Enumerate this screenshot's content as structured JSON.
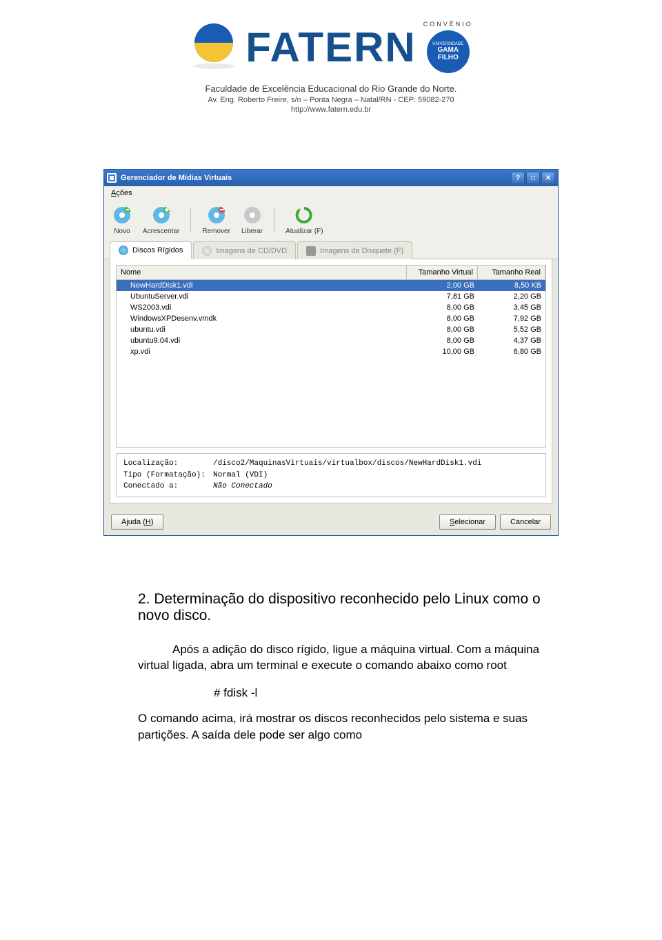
{
  "header": {
    "logo_text": "FATERN",
    "convenio_label": "CONVÊNIO",
    "gama_line1": "UNIVERSIDADE",
    "gama_line2": "GAMA",
    "gama_line3": "FILHO",
    "subtitle": "Faculdade de Excelência Educacional do Rio Grande do Norte.",
    "address": "Av. Eng. Roberto Freire, s/n – Ponta Negra – Natal/RN - CEP: 59082-270",
    "url": "http://www.fatern.edu.br"
  },
  "window": {
    "title": "Gerenciador de Mídias Virtuais",
    "menu": {
      "acoes": "Ações"
    },
    "toolbar": {
      "novo": "Novo",
      "acrescentar": "Acrescentar",
      "remover": "Remover",
      "liberar": "Liberar",
      "atualizar": "Atualizar (F)"
    },
    "tabs": {
      "discos": "Discos Rígidos",
      "cddvd": "Imagens de CD/DVD",
      "disquete": "Imagens de Disquete (F)"
    },
    "columns": {
      "nome": "Nome",
      "tam_virtual": "Tamanho Virtual",
      "tam_real": "Tamanho Real"
    },
    "rows": [
      {
        "name": "NewHardDisk1.vdi",
        "virt": "2,00 GB",
        "real": "8,50 KB",
        "selected": true
      },
      {
        "name": "UbuntuServer.vdi",
        "virt": "7,81 GB",
        "real": "2,20 GB",
        "selected": false
      },
      {
        "name": "WS2003.vdi",
        "virt": "8,00 GB",
        "real": "3,45 GB",
        "selected": false
      },
      {
        "name": "WindowsXPDesenv.vmdk",
        "virt": "8,00 GB",
        "real": "7,92 GB",
        "selected": false
      },
      {
        "name": "ubuntu.vdi",
        "virt": "8,00 GB",
        "real": "5,52 GB",
        "selected": false
      },
      {
        "name": "ubuntu9.04.vdi",
        "virt": "8,00 GB",
        "real": "4,37 GB",
        "selected": false
      },
      {
        "name": "xp.vdi",
        "virt": "10,00 GB",
        "real": "6,80 GB",
        "selected": false
      }
    ],
    "details": {
      "loc_label": "Localização:",
      "loc_val": "/disco2/MaquinasVirtuais/virtualbox/discos/NewHardDisk1.vdi",
      "tipo_label": "Tipo (Formatação):",
      "tipo_val": "Normal (VDI)",
      "conn_label": "Conectado a:",
      "conn_val": "Não Conectado"
    },
    "btns": {
      "ajuda": "Ajuda (H)",
      "selecionar": "Selecionar",
      "cancelar": "Cancelar"
    }
  },
  "doc": {
    "heading": "2. Determinação do dispositivo reconhecido pelo Linux como o novo disco.",
    "para1": "Após a adição do disco rígido, ligue a máquina virtual. Com  a máquina virtual ligada, abra um terminal e execute o comando abaixo como root",
    "cmd": "# fdisk -l",
    "para2": "O comando acima, irá mostrar os discos reconhecidos pelo sistema e suas partições. A saída dele pode ser algo como"
  }
}
